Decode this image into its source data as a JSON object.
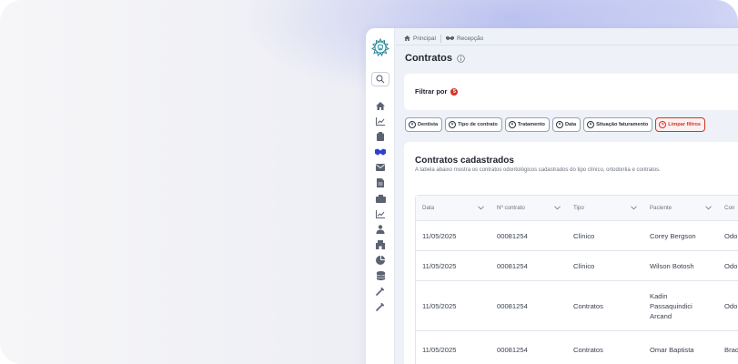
{
  "breadcrumb": [
    {
      "label": "Principal",
      "icon": "home-icon"
    },
    {
      "label": "Recepção",
      "icon": "handshake-icon"
    }
  ],
  "page": {
    "title": "Contratos",
    "info_icon": "info-icon"
  },
  "filter": {
    "label": "Filtrar por",
    "count": "5"
  },
  "chips": [
    {
      "label": "Dentista"
    },
    {
      "label": "Tipo de contrato"
    },
    {
      "label": "Tratamento"
    },
    {
      "label": "Data"
    },
    {
      "label": "Situação faturamento"
    }
  ],
  "clear_chip": {
    "label": "Limpar filtros"
  },
  "table_card": {
    "title": "Contratos cadastrados",
    "description": "A tabela abaixo mostra os contratos odontológicos cadastrados do tipo clínico, ortodontia e contratos."
  },
  "table": {
    "columns": [
      "Data",
      "Nº contrato",
      "Tipo",
      "Paciente",
      "Con"
    ],
    "rows": [
      {
        "data": "11/05/2025",
        "contrato": "00081254",
        "tipo": "Clínico",
        "paciente": "Corey Bergson",
        "con": "Odo"
      },
      {
        "data": "11/05/2025",
        "contrato": "00081254",
        "tipo": "Clínico",
        "paciente": "Wilson Botosh",
        "con": "Odo"
      },
      {
        "data": "11/05/2025",
        "contrato": "00081254",
        "tipo": "Contratos",
        "paciente_lines": [
          "Kadin",
          "Passaquindici",
          "Arcand"
        ],
        "con": "Odo"
      },
      {
        "data": "11/05/2025",
        "contrato": "00081254",
        "tipo": "Contratos",
        "paciente": "Omar Baptista",
        "con": "Brad"
      }
    ]
  },
  "sidebar_icons": [
    "logo-icon",
    "search-icon",
    "home-icon",
    "chart-icon",
    "clipboard-icon",
    "handshake-icon",
    "mail-icon",
    "document-icon",
    "box-icon",
    "chart-icon",
    "users-icon",
    "building-icon",
    "pie-chart-icon",
    "database-icon",
    "wrench-icon",
    "wrench-icon"
  ],
  "colors": {
    "accent": "#2f3fd0",
    "danger": "#d0342c",
    "background": "#eef2f8"
  }
}
